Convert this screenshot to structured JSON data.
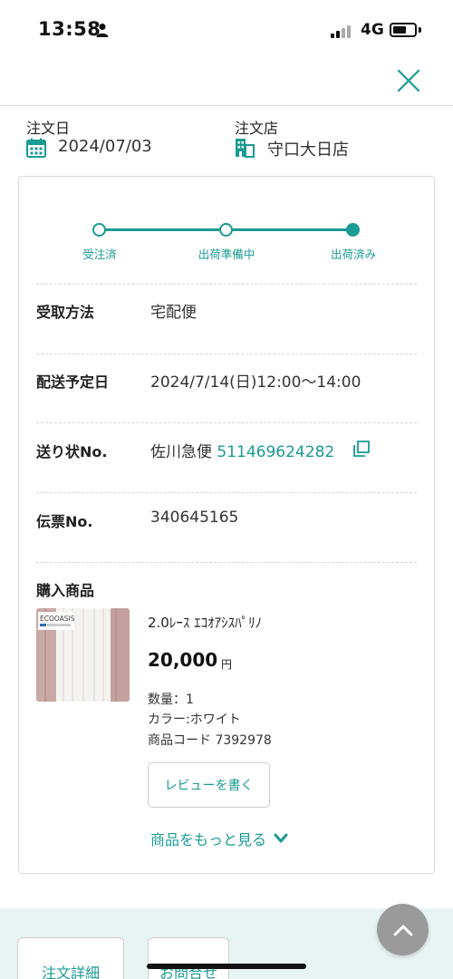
{
  "status_bar": {
    "time": "13:58",
    "network": "4G"
  },
  "order": {
    "date_label": "注文日",
    "date_value": "2024/07/03",
    "store_label": "注文店",
    "store_value": "守口大日店"
  },
  "progress": {
    "steps": [
      "受注済",
      "出荷準備中",
      "出荷済み"
    ],
    "current_step": 3
  },
  "details": {
    "receive_method_label": "受取方法",
    "receive_method_value": "宅配便",
    "delivery_date_label": "配送予定日",
    "delivery_date_value": "2024/7/14(日)12:00〜14:00",
    "tracking_label": "送り状No.",
    "tracking_carrier": "佐川急便",
    "tracking_number": "511469624282",
    "slip_label": "伝票No.",
    "slip_value": "340645165",
    "purchase_label": "購入商品"
  },
  "product": {
    "brand_text": "ECOOASIS",
    "name": "2.0ﾚｰｽ ｴｺｵｱｼｽﾊﾟﾘﾉ",
    "price": "20,000",
    "currency": "円",
    "quantity": "数量：1",
    "color": "カラー:ホワイト",
    "code": "商品コード 7392978",
    "review_button": "レビューを書く",
    "more_link": "商品をもっと見る"
  },
  "bottom": {
    "order_detail_button": "注文詳細",
    "inquiry_button": "お問合せ"
  },
  "colors": {
    "accent": "#1a9b93",
    "bottom_bg": "#e8f3f3"
  }
}
